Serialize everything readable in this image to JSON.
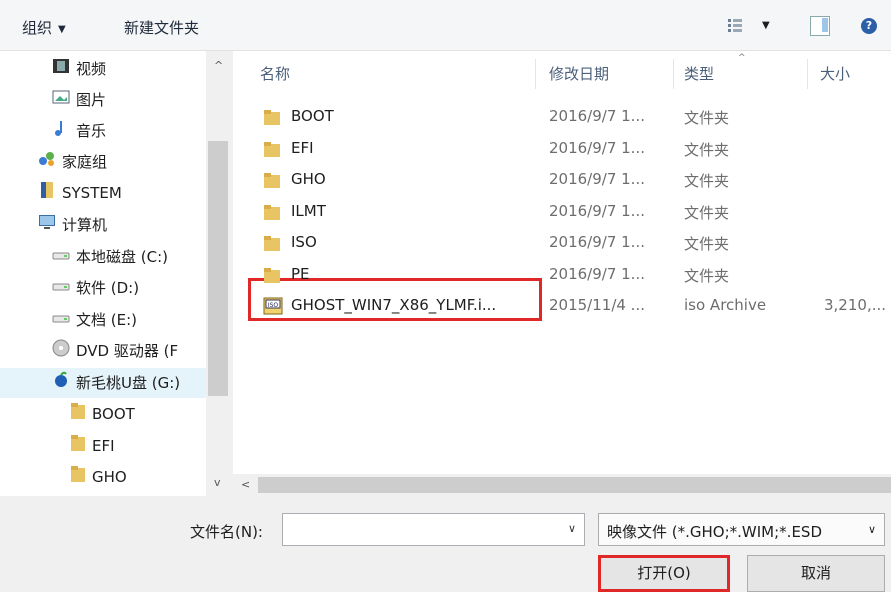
{
  "toolbar": {
    "organize_label": "组织",
    "new_folder_label": "新建文件夹",
    "caret": "▼",
    "help": "?"
  },
  "nav": {
    "items": [
      {
        "label": "视频",
        "icon": "video-icon"
      },
      {
        "label": "图片",
        "icon": "picture-icon"
      },
      {
        "label": "音乐",
        "icon": "music-icon"
      },
      {
        "label": "家庭组",
        "icon": "homegroup-icon"
      },
      {
        "label": "SYSTEM",
        "icon": "user-folder-icon"
      },
      {
        "label": "计算机",
        "icon": "computer-icon"
      },
      {
        "label": "本地磁盘 (C:)",
        "icon": "drive-icon"
      },
      {
        "label": "软件 (D:)",
        "icon": "drive-icon"
      },
      {
        "label": "文档 (E:)",
        "icon": "drive-icon"
      },
      {
        "label": "DVD 驱动器 (F",
        "icon": "dvd-icon"
      },
      {
        "label": "新毛桃U盘 (G:)",
        "icon": "usb-drive-icon",
        "selected": true
      },
      {
        "label": "BOOT",
        "icon": "folder-icon"
      },
      {
        "label": "EFI",
        "icon": "folder-icon"
      },
      {
        "label": "GHO",
        "icon": "folder-icon"
      }
    ],
    "scroll_up": "^",
    "scroll_down": "v"
  },
  "columns": {
    "name": "名称",
    "date": "修改日期",
    "type": "类型",
    "size": "大小"
  },
  "files": [
    {
      "name": "BOOT",
      "date": "2016/9/7 1...",
      "type": "文件夹",
      "size": "",
      "icon": "folder-icon"
    },
    {
      "name": "EFI",
      "date": "2016/9/7 1...",
      "type": "文件夹",
      "size": "",
      "icon": "folder-icon"
    },
    {
      "name": "GHO",
      "date": "2016/9/7 1...",
      "type": "文件夹",
      "size": "",
      "icon": "folder-icon"
    },
    {
      "name": "ILMT",
      "date": "2016/9/7 1...",
      "type": "文件夹",
      "size": "",
      "icon": "folder-icon"
    },
    {
      "name": "ISO",
      "date": "2016/9/7 1...",
      "type": "文件夹",
      "size": "",
      "icon": "folder-icon"
    },
    {
      "name": "PE",
      "date": "2016/9/7 1...",
      "type": "文件夹",
      "size": "",
      "icon": "folder-icon"
    },
    {
      "name": "GHOST_WIN7_X86_YLMF.i...",
      "date": "2015/11/4 ...",
      "type": "iso Archive",
      "size": "3,210,...",
      "icon": "iso-file-icon",
      "highlighted": true
    }
  ],
  "hscroll_left": "<",
  "filename": {
    "label": "文件名(N):",
    "value": "",
    "dropdown": "∨"
  },
  "filter": {
    "value": "映像文件 (*.GHO;*.WIM;*.ESD",
    "dropdown": "∨"
  },
  "buttons": {
    "open": "打开(O)",
    "cancel": "取消"
  },
  "colors": {
    "highlight": "#e02828",
    "folder": "#e8c463",
    "selection": "#e5f3fb"
  }
}
